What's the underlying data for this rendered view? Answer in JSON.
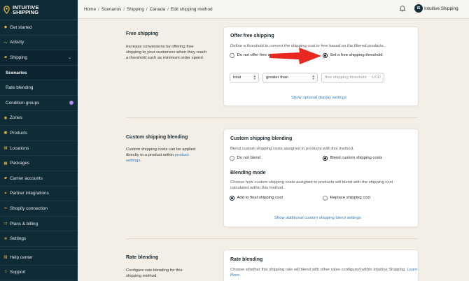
{
  "app": {
    "logo_line1": "INTUITIVE",
    "logo_line2": "SHIPPING"
  },
  "sidebar": {
    "items": [
      {
        "label": "Get started",
        "icon": "tag-icon"
      },
      {
        "label": "Activity",
        "icon": "pulse-icon"
      },
      {
        "label": "Shipping",
        "icon": "truck-icon"
      },
      {
        "label": "Scenarios"
      },
      {
        "label": "Rate blending"
      },
      {
        "label": "Condition groups",
        "badge": "i"
      },
      {
        "label": "Zones",
        "icon": "globe-icon"
      },
      {
        "label": "Products",
        "icon": "box-icon"
      },
      {
        "label": "Locations",
        "icon": "location-icon"
      },
      {
        "label": "Packages",
        "icon": "package-icon"
      },
      {
        "label": "Carrier accounts",
        "icon": "truck-icon"
      },
      {
        "label": "Partner integrations",
        "icon": "plug-icon"
      },
      {
        "label": "Shopify connection",
        "icon": "link-icon"
      },
      {
        "label": "Plans & billing",
        "icon": "card-icon"
      },
      {
        "label": "Settings",
        "icon": "gear-icon"
      }
    ],
    "bottom": [
      {
        "label": "Help center",
        "icon": "help-icon"
      },
      {
        "label": "Support",
        "icon": "support-icon"
      }
    ]
  },
  "topbar": {
    "breadcrumbs": [
      "Home",
      "Scenarios",
      "Shipping",
      "Canada",
      "Edit shipping method"
    ],
    "user_initials": "IS",
    "user_name": "Intuitive Shipping"
  },
  "free_shipping": {
    "section_title": "Free shipping",
    "section_desc": "Increase conversions by offering free shipping to your customers when they reach a threshold such as minimum order spend.",
    "card_title": "Offer free shipping",
    "card_desc": "Define a threshold to convert the shipping cost to free based on the filtered products.",
    "option_off": "Do not offer free s",
    "option_on": "Set a free shipping threshold",
    "selected": "threshold",
    "field_select": "total",
    "operator_select": "greater than",
    "threshold_placeholder": "free shipping threshold",
    "currency": "USD",
    "link": "Show optional display settings"
  },
  "custom_blending": {
    "section_title": "Custom shipping blending",
    "section_desc_before": "Custom shipping costs can be applied directly to a product within ",
    "section_desc_link": "product settings",
    "section_desc_after": ".",
    "card_title": "Custom shipping blending",
    "card_desc": "Blend custom shipping costs assigned to products with this method.",
    "option_off": "Do not blend",
    "option_on": "Blend custom shipping costs",
    "mode_title": "Blending mode",
    "mode_desc": "Choose how custom shipping costs assigned to products will blend with the shipping cost calculated within this method.",
    "mode_add": "Add to final shipping cost",
    "mode_replace": "Replace shipping cost",
    "link": "Show additional custom shipping blend settings"
  },
  "rate_blending": {
    "section_title": "Rate blending",
    "section_desc": "Configure rate blending for this shipping method.",
    "card_title": "Rate blending",
    "card_desc_before": "Choose whether this shipping rate will blend with other rates configured within Intuitive Shipping. ",
    "card_desc_link": "Learn More."
  },
  "colors": {
    "sidebar_bg": "#0f2b36",
    "accent_link": "#2f7ab8",
    "annotation_arrow": "#e8281e",
    "icon_yellow": "#f2c24b"
  }
}
